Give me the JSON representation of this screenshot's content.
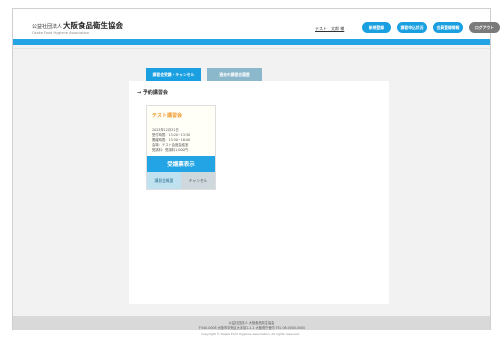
{
  "header": {
    "org_prefix": "公益社団法人",
    "org_name": "大阪食品衛生協会",
    "org_sub": "Osaka Food Hygiene Association",
    "user_name": "テスト　太郎 様",
    "buttons": [
      "新規登録",
      "講習申込状況",
      "会員登録情報",
      "ログアウト"
    ]
  },
  "tabs": {
    "tab1": "講習会受講・キャンセル",
    "tab2": "過去の講習会履歴"
  },
  "section": {
    "title": "→ 予約講習会"
  },
  "card": {
    "title": "テスト講習会",
    "date": "2023年12月31日",
    "reception": "受付時間：13:20~13:30",
    "time": "開催時間：13:30~16:00",
    "venue": "会場：テスト会館会議室",
    "fee": "受講料：受講料1,000円",
    "main_button": "受講票表示",
    "sub_button_1": "講習会概要",
    "sub_button_2": "キャンセル"
  },
  "footer": {
    "line1": "公益社団法人 大阪食品衛生協会",
    "line2": "〒540-0008 大阪市中央区大手前1-1-1 大阪府庁舎内 TEL 06-0000-0000",
    "copyright": "Copyright © Osaka Food Hygiene Association, All rights reserved."
  }
}
